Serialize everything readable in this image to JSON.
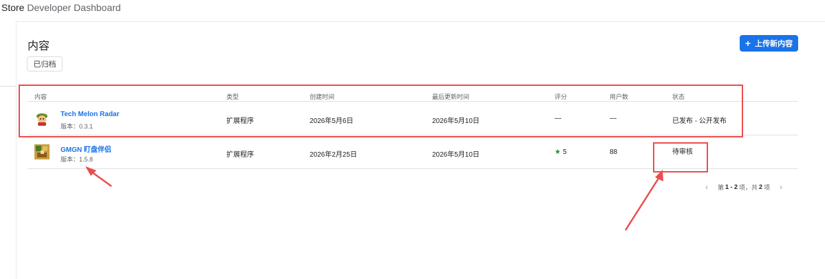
{
  "header": {
    "brand_part1": "Store",
    "brand_part2": "Developer Dashboard"
  },
  "page": {
    "title": "内容",
    "filter_chip": "已归档",
    "upload_button": "上传新内容",
    "upload_icon": "plus-icon"
  },
  "table": {
    "columns": [
      "内容",
      "类型",
      "创建时间",
      "最后更新时间",
      "评分",
      "用户数",
      "状态"
    ],
    "rows": [
      {
        "name": "Tech Melon Radar",
        "version": "版本：0.3.1",
        "type": "扩展程序",
        "created": "2026年5月6日",
        "updated": "2026年5月10日",
        "rating": "—",
        "users": "—",
        "status": "已发布 - 公开发布",
        "icon": "cartoon-avatar-icon"
      },
      {
        "name": "GMGN 盯盘伴侣",
        "version": "版本：1.5.8",
        "type": "扩展程序",
        "created": "2026年2月25日",
        "updated": "2026年5月10日",
        "rating": "5",
        "users": "88",
        "status": "待审核",
        "icon": "pixel-art-icon"
      }
    ]
  },
  "pagination": {
    "prefix": "第",
    "range": "1 - 2",
    "mid": "项，共",
    "total": "2",
    "suffix": "项"
  },
  "colors": {
    "accent": "#1a73e8",
    "highlight": "#ea4d4f",
    "rating_star": "#1e8e3e"
  }
}
